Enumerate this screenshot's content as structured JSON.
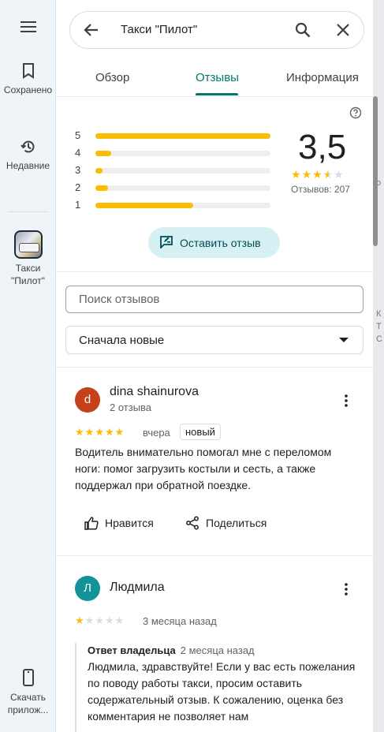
{
  "rail": {
    "menu_icon": "hamburger-icon",
    "saved": {
      "icon": "bookmark-icon",
      "label": "Сохранено"
    },
    "recent": {
      "icon": "history-icon",
      "label": "Недавние"
    },
    "place": {
      "label": "Такси \"Пилот\""
    },
    "download": {
      "icon": "phone-icon",
      "label": "Скачать прилож..."
    }
  },
  "search": {
    "query": "Такси \"Пилот\"",
    "back_icon": "arrow-back-icon",
    "search_icon": "search-icon",
    "clear_icon": "close-icon"
  },
  "tabs": [
    {
      "label": "Обзор",
      "active": false
    },
    {
      "label": "Отзывы",
      "active": true
    },
    {
      "label": "Информация",
      "active": false
    }
  ],
  "rating": {
    "distribution": [
      {
        "stars": "5",
        "fraction": 1.0
      },
      {
        "stars": "4",
        "fraction": 0.09
      },
      {
        "stars": "3",
        "fraction": 0.04
      },
      {
        "stars": "2",
        "fraction": 0.07
      },
      {
        "stars": "1",
        "fraction": 0.56
      }
    ],
    "value": "3,5",
    "stars": 3.5,
    "count_label": "Отзывов: 207"
  },
  "write_review": {
    "label": "Оставить отзыв",
    "icon": "rate-review-icon"
  },
  "review_search": {
    "placeholder": "Поиск отзывов"
  },
  "sort": {
    "selected": "Сначала новые"
  },
  "reviews": [
    {
      "avatar_letter": "d",
      "avatar_color": "#c5411b",
      "author": "dina shainurova",
      "sub": "2 отзыва",
      "stars": 5,
      "date": "вчера",
      "badge": "новый",
      "text": "Водитель внимательно помогал мне с переломом ноги: помог загрузить костыли и сесть, а также поддержал при обратной поездке.",
      "like_label": "Нравится",
      "share_label": "Поделиться"
    },
    {
      "avatar_letter": "Л",
      "avatar_color": "#12939a",
      "author": "Людмила",
      "stars": 1,
      "date": "3 месяца назад",
      "owner_reply": {
        "title": "Ответ владельца",
        "date": "2 месяца назад",
        "text": "Людмила, здравствуйте! Если у вас есть пожелания по поводу работы такси, просим оставить содержательный отзыв. К сожалению, оценка без комментария не позволяет нам"
      }
    }
  ],
  "colors": {
    "accent": "#00796b",
    "star": "#fbbc04",
    "button_bg": "#d7f0f4"
  }
}
